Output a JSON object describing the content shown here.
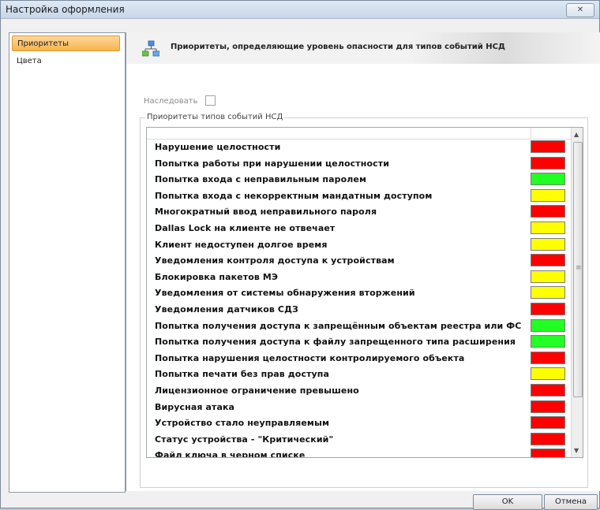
{
  "window": {
    "title": "Настройка оформления",
    "close_glyph": "✕"
  },
  "sidebar": {
    "items": [
      {
        "label": "Приоритеты"
      },
      {
        "label": "Цвета"
      }
    ]
  },
  "header": {
    "title": "Приоритеты, определяющие уровень опасности для типов событий НСД",
    "icon": "network-icon"
  },
  "inherit": {
    "label": "Наследовать",
    "checked": false
  },
  "group": {
    "label": "Приоритеты типов событий НСД"
  },
  "colors": {
    "red": "#ff0000",
    "green": "#22ff22",
    "yellow": "#ffff00"
  },
  "events": [
    {
      "label": "Нарушение целостности",
      "color": "red"
    },
    {
      "label": "Попытка работы при нарушении целостности",
      "color": "red"
    },
    {
      "label": "Попытка входа с неправильным паролем",
      "color": "green"
    },
    {
      "label": "Попытка входа с некорректным мандатным доступом",
      "color": "yellow"
    },
    {
      "label": "Многократный ввод неправильного пароля",
      "color": "red"
    },
    {
      "label": "Dallas Lock на клиенте не отвечает",
      "color": "yellow"
    },
    {
      "label": "Клиент недоступен долгое время",
      "color": "yellow"
    },
    {
      "label": "Уведомления контроля доступа к устройствам",
      "color": "red"
    },
    {
      "label": "Блокировка пакетов МЭ",
      "color": "yellow"
    },
    {
      "label": "Уведомления от системы обнаружения вторжений",
      "color": "yellow"
    },
    {
      "label": "Уведомления датчиков СДЗ",
      "color": "red"
    },
    {
      "label": "Попытка получения доступа к запрещённым объектам реестра или ФС",
      "color": "green"
    },
    {
      "label": "Попытка получения доступа к файлу запрещенного типа расширения",
      "color": "green"
    },
    {
      "label": "Попытка нарушения целостности контролируемого объекта",
      "color": "red"
    },
    {
      "label": "Попытка печати без прав доступа",
      "color": "yellow"
    },
    {
      "label": "Лицензионное ограничение превышено",
      "color": "red"
    },
    {
      "label": "Вирусная атака",
      "color": "red"
    },
    {
      "label": "Устройство стало неуправляемым",
      "color": "red"
    },
    {
      "label": "Статус устройства - \"Критический\"",
      "color": "red"
    },
    {
      "label": "Файл ключа в черном списке",
      "color": "red"
    }
  ],
  "buttons": {
    "ok": "OK",
    "cancel": "Отмена"
  }
}
